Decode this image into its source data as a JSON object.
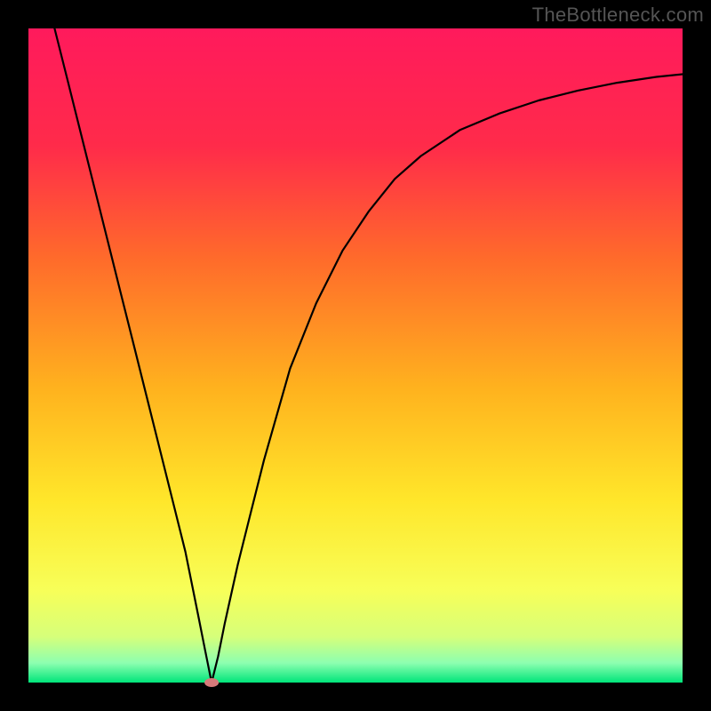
{
  "watermark": "TheBottleneck.com",
  "chart_data": {
    "type": "line",
    "title": "",
    "xlabel": "",
    "ylabel": "",
    "xlim": [
      0,
      100
    ],
    "ylim": [
      0,
      100
    ],
    "grid": false,
    "legend": false,
    "background_gradient": {
      "stops": [
        {
          "offset": 0.0,
          "color": "#ff1a5c"
        },
        {
          "offset": 0.18,
          "color": "#ff2b4a"
        },
        {
          "offset": 0.35,
          "color": "#ff6a2b"
        },
        {
          "offset": 0.55,
          "color": "#ffb21e"
        },
        {
          "offset": 0.72,
          "color": "#ffe62a"
        },
        {
          "offset": 0.86,
          "color": "#f7ff59"
        },
        {
          "offset": 0.93,
          "color": "#d6ff7a"
        },
        {
          "offset": 0.97,
          "color": "#8dffb0"
        },
        {
          "offset": 1.0,
          "color": "#00e57a"
        }
      ]
    },
    "minimum_marker": {
      "x": 28,
      "y": 0,
      "color": "#d67a7a",
      "rx": 8,
      "ry": 5
    },
    "series": [
      {
        "name": "curve",
        "color": "#000000",
        "stroke_width": 2.2,
        "x": [
          4,
          6,
          8,
          10,
          12,
          14,
          16,
          18,
          20,
          22,
          24,
          26,
          27,
          28,
          29,
          30,
          32,
          34,
          36,
          38,
          40,
          44,
          48,
          52,
          56,
          60,
          66,
          72,
          78,
          84,
          90,
          96,
          100
        ],
        "y": [
          100,
          92,
          84,
          76,
          68,
          60,
          52,
          44,
          36,
          28,
          20,
          10,
          5,
          0,
          4,
          9,
          18,
          26,
          34,
          41,
          48,
          58,
          66,
          72,
          77,
          80.5,
          84.5,
          87,
          89,
          90.5,
          91.7,
          92.6,
          93
        ]
      }
    ]
  }
}
